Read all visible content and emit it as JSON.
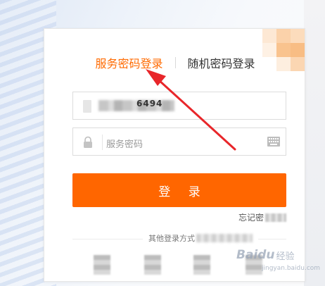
{
  "tabs": {
    "service_password_login": "服务密码登录",
    "random_password_login": "随机密码登录",
    "active": "service_password_login"
  },
  "account_field": {
    "value_partial": "6494"
  },
  "password_field": {
    "placeholder": "服务密码"
  },
  "login_button": {
    "label": "登 录"
  },
  "forgot_link": {
    "label_partial": "忘记密"
  },
  "other_login": {
    "label_partial": "其他登录方式"
  },
  "watermark": {
    "brand": "Baidu",
    "suffix": "经验",
    "url": "jingyan.baidu.com"
  },
  "colors": {
    "accent": "#ff6600",
    "tab_active": "#ff6a00",
    "annotation_arrow": "#e8262a"
  },
  "icons": {
    "lock": "lock-icon",
    "keyboard": "keyboard-icon",
    "account": "user-icon"
  }
}
